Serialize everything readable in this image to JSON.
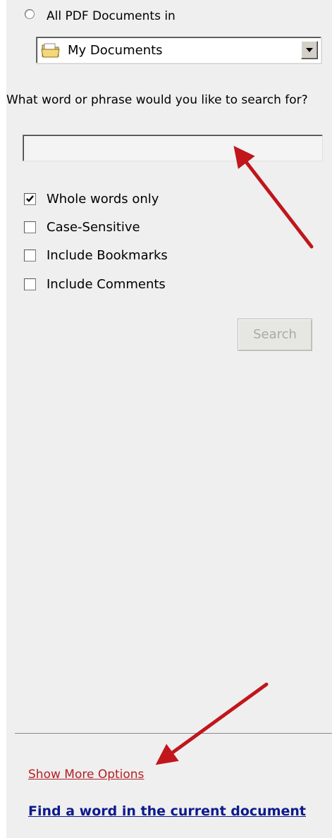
{
  "scope": {
    "radio_label": "All PDF Documents in",
    "location_value": "My Documents"
  },
  "search": {
    "prompt": "What word or phrase would you like to search for?",
    "value": ""
  },
  "options": [
    {
      "label": "Whole words only",
      "checked": true
    },
    {
      "label": "Case-Sensitive",
      "checked": false
    },
    {
      "label": "Include Bookmarks",
      "checked": false
    },
    {
      "label": "Include Comments",
      "checked": false
    }
  ],
  "search_button_label": "Search",
  "links": {
    "more_options": "Show More Options",
    "find_current": "Find a word in the current document"
  },
  "colors": {
    "link_red": "#b32025",
    "link_blue": "#0c1a8c",
    "annotation_arrow": "#c0161c"
  }
}
